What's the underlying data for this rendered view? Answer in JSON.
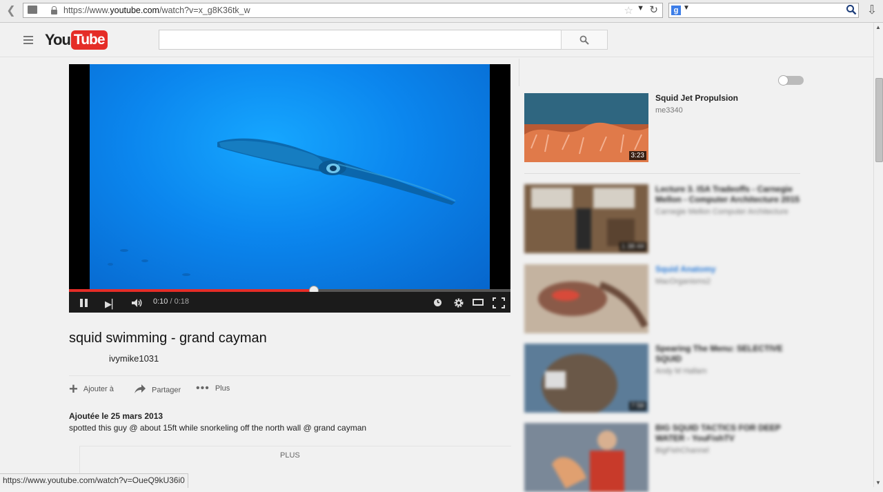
{
  "browser": {
    "url_prefix": "https://www.",
    "url_host": "youtube.com",
    "url_path": "/watch?v=x_g8K36tk_w",
    "search_engine_letter": "g"
  },
  "youtube": {
    "logo_you": "You",
    "logo_tube": "Tube",
    "search_placeholder": ""
  },
  "player": {
    "current_time": "0:10",
    "time_sep": " / ",
    "duration": "0:18",
    "progress_fraction": 0.555
  },
  "video": {
    "title": "squid swimming - grand cayman",
    "channel": "ivymike1031",
    "actions": {
      "add": "Ajouter à",
      "share": "Partager",
      "more": "Plus"
    },
    "added_date": "Ajoutée le 25 mars 2013",
    "description": "spotted this guy @ about 15ft while snorkeling off the north wall @ grand cayman",
    "show_more": "PLUS"
  },
  "sidebar": {
    "recommendations": [
      {
        "title": "Squid Jet Propulsion",
        "channel": "me3340",
        "duration": "3:23",
        "colors": [
          "#3a6f8a",
          "#d9633a"
        ]
      },
      {
        "title": "Lecture 3. ISA Tradeoffs - Carnegie Mellon - Computer Architecture 2015",
        "channel": "Carnegie Mellon Computer Architecture",
        "duration": "1:38:44",
        "colors": [
          "#8a6a4a",
          "#d8cfc0"
        ]
      },
      {
        "title": "Squid Anatomy",
        "channel": "MacOrganisms2",
        "duration": "",
        "colors": [
          "#c8b6a2",
          "#6a4a3a"
        ]
      },
      {
        "title": "Spearing The Menu: SELECTIVE SQUID",
        "channel": "Andy M Hallam",
        "duration": "7:58",
        "colors": [
          "#4a6a8a",
          "#6a5a4a"
        ]
      },
      {
        "title": "BIG SQUID TACTICS FOR DEEP WATER - YouFishTV",
        "channel": "BigFishChannel",
        "duration": "",
        "colors": [
          "#6a7a8a",
          "#c83a2a"
        ]
      }
    ]
  },
  "status_bar": {
    "url": "https://www.youtube.com/watch?v=OueQ9kU36i0"
  }
}
